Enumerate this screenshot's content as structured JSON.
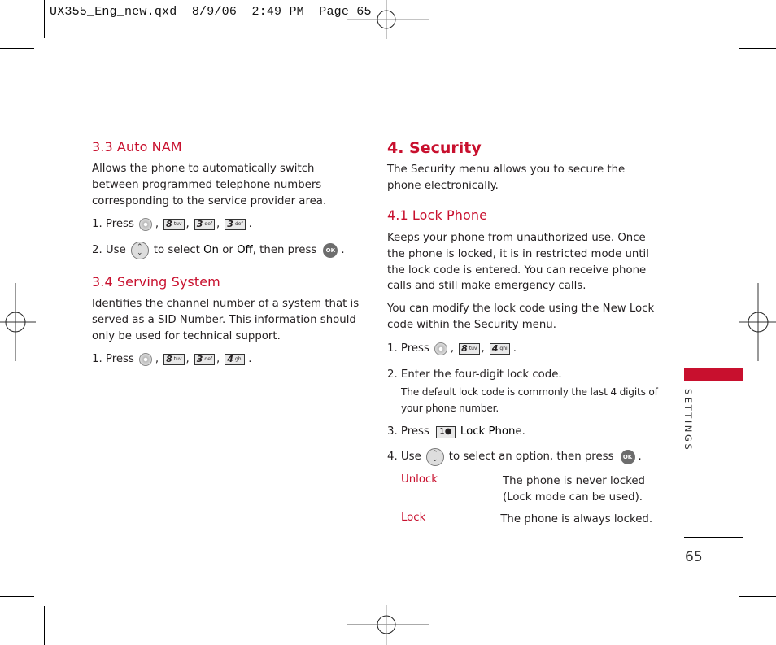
{
  "slug": {
    "text": "UX355_Eng_new.qxd  8/9/06  2:49 PM  Page 65"
  },
  "left_column": {
    "auto_nam": {
      "heading": "3.3 Auto NAM",
      "description": "Allows the phone to automatically switch between programmed telephone numbers corresponding to the service provider area.",
      "step1": {
        "prefix": "1. Press",
        "keys": [
          {
            "digit": "8",
            "letters": "tuv"
          },
          {
            "digit": "3",
            "letters": "def"
          },
          {
            "digit": "3",
            "letters": "def"
          }
        ],
        "suffix": "."
      },
      "step2": {
        "prefix": "2. Use",
        "middle": "to select",
        "opt_on": "On",
        "or": "or",
        "opt_off": "Off",
        "then": ", then press",
        "suffix": "."
      }
    },
    "serving_system": {
      "heading": "3.4 Serving System",
      "description": "Identifies the channel number of a system that is served as a SID Number. This information should only be used for technical support.",
      "step1": {
        "prefix": "1. Press",
        "keys": [
          {
            "digit": "8",
            "letters": "tuv"
          },
          {
            "digit": "3",
            "letters": "def"
          },
          {
            "digit": "4",
            "letters": "ghi"
          }
        ],
        "suffix": "."
      }
    }
  },
  "right_column": {
    "security": {
      "heading": "4. Security",
      "description": "The Security menu allows you to secure the phone electronically."
    },
    "lock_phone": {
      "heading": "4.1 Lock Phone",
      "description1": "Keeps your phone from unauthorized use. Once the phone is locked, it is in restricted mode until the lock code is entered. You can receive phone calls and still make emergency calls.",
      "description2": "You can modify the lock code using the New Lock code within the Security menu.",
      "step1": {
        "prefix": "1. Press",
        "keys": [
          {
            "digit": "8",
            "letters": "tuv"
          },
          {
            "digit": "4",
            "letters": "ghi"
          }
        ],
        "suffix": "."
      },
      "step2": {
        "text": "2. Enter the four-digit lock code.",
        "note": "The default lock code is commonly the last 4 digits of your phone number."
      },
      "step3": {
        "prefix": "3. Press",
        "key_label": "1",
        "action": "Lock Phone",
        "suffix": "."
      },
      "step4": {
        "prefix": "4. Use",
        "middle": "to select an option, then press",
        "suffix": "."
      },
      "options": [
        {
          "label": "Unlock",
          "description": "The phone is never locked (Lock mode can be used)."
        },
        {
          "label": "Lock",
          "description": "The phone is always locked."
        }
      ]
    }
  },
  "sidebar": {
    "section_label": "SETTINGS",
    "accent_color": "#c8102e"
  },
  "page_number": "65",
  "icons": {
    "menu_button": "menu-center-key-icon",
    "nav_button": "up-down-navigation-key-icon",
    "ok_button": "ok-key-icon",
    "ok_text": "OK"
  }
}
